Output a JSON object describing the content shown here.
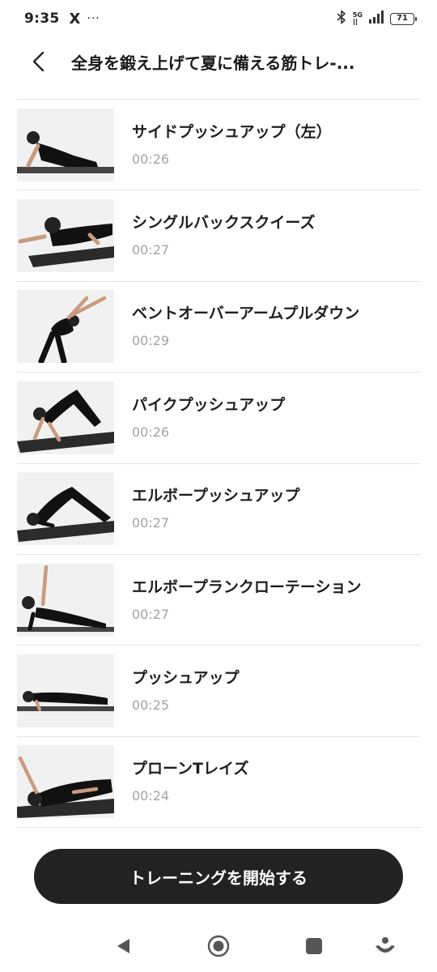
{
  "status_bar": {
    "time": "9:35",
    "app_icon": "X",
    "more": "···",
    "network": "5G",
    "battery": "71"
  },
  "header": {
    "back_icon": "chevron-left-icon",
    "title": "全身を鍛え上げて夏に備える筋トレ-..."
  },
  "exercises": [
    {
      "name": "サイドプッシュアップ（左）",
      "duration": "00:26"
    },
    {
      "name": "シングルバックスクイーズ",
      "duration": "00:27"
    },
    {
      "name": "ベントオーバーアームプルダウン",
      "duration": "00:29"
    },
    {
      "name": "パイクプッシュアップ",
      "duration": "00:26"
    },
    {
      "name": "エルボープッシュアップ",
      "duration": "00:27"
    },
    {
      "name": "エルボープランクローテーション",
      "duration": "00:27"
    },
    {
      "name": "プッシュアップ",
      "duration": "00:25"
    },
    {
      "name": "プローンTレイズ",
      "duration": "00:24"
    }
  ],
  "start_button": {
    "label": "トレーニングを開始する"
  },
  "colors": {
    "button_bg": "#222222",
    "duration_text": "#a3a3a3",
    "divider": "#e3e3e3"
  }
}
